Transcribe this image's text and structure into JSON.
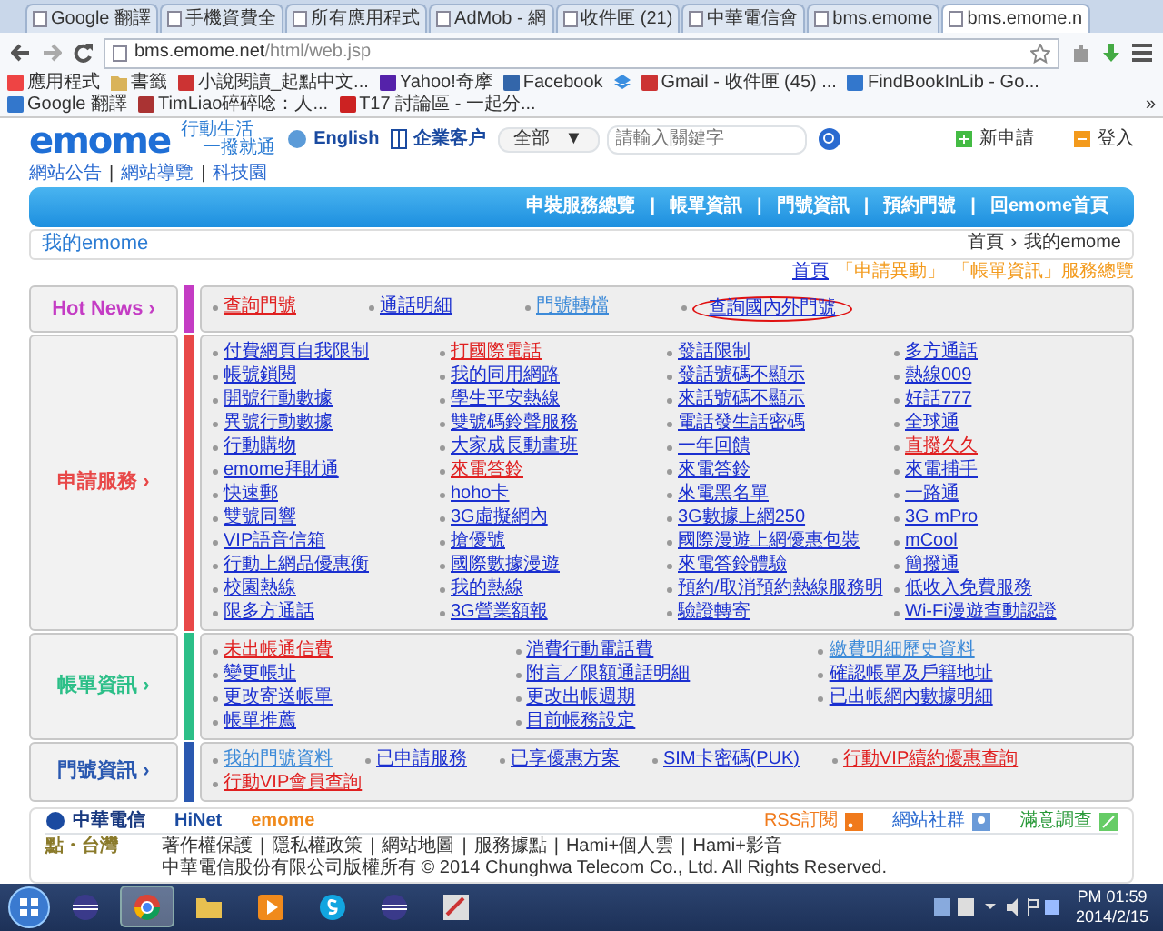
{
  "browser": {
    "tabs": [
      {
        "title": "Google 翻譯",
        "selected": false
      },
      {
        "title": "手機資費全",
        "selected": false
      },
      {
        "title": "所有應用程式",
        "selected": false
      },
      {
        "title": "AdMob - 網",
        "selected": false
      },
      {
        "title": "收件匣 (21)",
        "selected": false
      },
      {
        "title": "中華電信會",
        "selected": false
      },
      {
        "title": "bms.emome",
        "selected": false
      },
      {
        "title": "bms.emome.n",
        "selected": true
      }
    ],
    "url_host": "bms.emome.net",
    "url_path": "/html/web.jsp",
    "bookmarks": [
      "應用程式",
      "書籤",
      "小說閱讀_起點中文...",
      "Yahoo!奇摩",
      "Facebook",
      "Gmail - 收件匣 (45) ...",
      "FindBookInLib - Go...",
      "Google 翻譯",
      "TimLiao碎碎唸：人...",
      "T17 討論區 - 一起分..."
    ],
    "bookmarks_more": "»"
  },
  "header": {
    "logo": "emome",
    "slogan": [
      "行動生活",
      "一撥就通"
    ],
    "english": "English",
    "enterprise": "企業客户",
    "scope": "全部",
    "scope_arrow": "▼",
    "search_placeholder": "請輸入關鍵字",
    "new_apply": "新申請",
    "login": "登入"
  },
  "top_links": {
    "items": [
      "網站公告",
      "網站導覽",
      "科技園"
    ],
    "separator": "|"
  },
  "nav": {
    "items": [
      "申裝服務總覽",
      "帳單資訊",
      "門號資訊",
      "預約門號",
      "回emome首頁"
    ],
    "separator": "|"
  },
  "title_bar": {
    "title": "我的emome",
    "breadcrumb": [
      "首頁",
      "我的emome"
    ],
    "separator": "›"
  },
  "crumbs": [
    "首頁",
    "「申請異動」",
    "「帳單資訊」服務總覽"
  ],
  "sections": [
    {
      "title": "Hot News",
      "arrow": "›",
      "color": "#c43cc4",
      "kind": "inline",
      "items": [
        {
          "label": "查詢門號",
          "kind": "hot",
          "circled": false
        },
        {
          "label": "通話明細",
          "kind": "link",
          "circled": false
        },
        {
          "label": "門號轉檔",
          "kind": "visited",
          "circled": false
        },
        {
          "label": "查詢國內外門號",
          "kind": "link",
          "circled": true
        }
      ]
    },
    {
      "title": "申請服務",
      "arrow": "›",
      "color": "#e84848",
      "kind": "grid",
      "items": [
        {
          "label": "付費網頁自我限制",
          "kind": "link"
        },
        {
          "label": "打國際電話",
          "kind": "hot"
        },
        {
          "label": "發話限制",
          "kind": "link"
        },
        {
          "label": "多方通話",
          "kind": "link"
        },
        {
          "label": "帳號鎖閱",
          "kind": "link"
        },
        {
          "label": "我的同用網路",
          "kind": "link"
        },
        {
          "label": "發話號碼不顯示",
          "kind": "link"
        },
        {
          "label": "熱線009",
          "kind": "link"
        },
        {
          "label": "開號行動數據",
          "kind": "link"
        },
        {
          "label": "學生平安熱線",
          "kind": "link"
        },
        {
          "label": "來話號碼不顯示",
          "kind": "link"
        },
        {
          "label": "好話777",
          "kind": "link"
        },
        {
          "label": "異號行動數據",
          "kind": "link"
        },
        {
          "label": "雙號碼鈴聲服務",
          "kind": "link"
        },
        {
          "label": "電話發生話密碼",
          "kind": "link"
        },
        {
          "label": "全球通",
          "kind": "link"
        },
        {
          "label": "行動購物",
          "kind": "link"
        },
        {
          "label": "大家成長動畫班",
          "kind": "link"
        },
        {
          "label": "一年回饋",
          "kind": "link"
        },
        {
          "label": "直撥久久",
          "kind": "hot"
        },
        {
          "label": "emome拜財通",
          "kind": "link"
        },
        {
          "label": "來電答鈴",
          "kind": "hot"
        },
        {
          "label": "來電答鈴",
          "kind": "link"
        },
        {
          "label": "來電捕手",
          "kind": "link"
        },
        {
          "label": "快速郵",
          "kind": "link"
        },
        {
          "label": "hoho卡",
          "kind": "link"
        },
        {
          "label": "來電黑名單",
          "kind": "link"
        },
        {
          "label": "一路通",
          "kind": "link"
        },
        {
          "label": "雙號同響",
          "kind": "link"
        },
        {
          "label": "3G虛擬網內",
          "kind": "link"
        },
        {
          "label": "3G數據上網250",
          "kind": "link"
        },
        {
          "label": "3G mPro",
          "kind": "link"
        },
        {
          "label": "VIP語音信箱",
          "kind": "link"
        },
        {
          "label": "搶優號",
          "kind": "link"
        },
        {
          "label": "國際漫遊上網優惠包裝",
          "kind": "link"
        },
        {
          "label": "mCool",
          "kind": "link"
        },
        {
          "label": "行動上網品優惠衡",
          "kind": "link"
        },
        {
          "label": "國際數據漫遊",
          "kind": "link"
        },
        {
          "label": "來電答鈴體驗",
          "kind": "link"
        },
        {
          "label": "簡撥通",
          "kind": "link"
        },
        {
          "label": "校園熱線",
          "kind": "link"
        },
        {
          "label": "我的熱線",
          "kind": "link"
        },
        {
          "label": "預約/取消預約熱線服務明",
          "kind": "link"
        },
        {
          "label": "低收入免費服務",
          "kind": "link"
        },
        {
          "label": "限多方通話",
          "kind": "link"
        },
        {
          "label": "3G營業額報",
          "kind": "link"
        },
        {
          "label": "驗證轉寄",
          "kind": "link"
        },
        {
          "label": "Wi-Fi漫遊查動認證",
          "kind": "link"
        }
      ]
    },
    {
      "title": "帳單資訊",
      "arrow": "›",
      "color": "#2cbf88",
      "kind": "table",
      "items": [
        {
          "label": "未出帳通信費",
          "kind": "hot"
        },
        {
          "label": "消費行動電話費",
          "kind": "link"
        },
        {
          "label": "繳費明細歷史資料",
          "kind": "visited"
        },
        {
          "label": "變更帳址",
          "kind": "link"
        },
        {
          "label": "附言／限額通話明細",
          "kind": "link"
        },
        {
          "label": "確認帳單及戶籍地址",
          "kind": "link"
        },
        {
          "label": "更改寄送帳單",
          "kind": "link"
        },
        {
          "label": "更改出帳週期",
          "kind": "link"
        },
        {
          "label": "已出帳網內數據明細",
          "kind": "link"
        },
        {
          "label": "帳單推薦",
          "kind": "link"
        },
        {
          "label": "目前帳務設定",
          "kind": "link"
        }
      ]
    },
    {
      "title": "門號資訊",
      "arrow": "›",
      "color": "#2a58b0",
      "kind": "inline",
      "items": [
        {
          "label": "我的門號資料",
          "kind": "visited"
        },
        {
          "label": "已申請服務",
          "kind": "link"
        },
        {
          "label": "已享優惠方案",
          "kind": "link"
        },
        {
          "label": "SIM卡密碼(PUK)",
          "kind": "link"
        },
        {
          "label": "行動VIP續約優惠查詢",
          "kind": "hot"
        },
        {
          "label": "行動VIP會員查詢",
          "kind": "hot"
        }
      ]
    }
  ],
  "footer": {
    "brands": [
      "中華電信",
      "HiNet",
      "emome"
    ],
    "badge": "點・台灣",
    "actions": [
      "RSS訂閱",
      "網站社群",
      "滿意調查"
    ],
    "link_separator": "|",
    "links": [
      "著作權保護",
      "隱私權政策",
      "網站地圖",
      "服務據點",
      "Hami+個人雲",
      "Hami+影音"
    ],
    "copyright": "中華電信股份有限公司版權所有 © 2014 Chunghwa Telecom Co., Ltd. All Rights Reserved."
  },
  "taskbar": {
    "apps": [
      {
        "kind": "eclipse",
        "selected": false
      },
      {
        "kind": "chrome",
        "selected": true
      },
      {
        "kind": "folder",
        "selected": false
      },
      {
        "kind": "media",
        "selected": false
      },
      {
        "kind": "skype",
        "selected": false
      },
      {
        "kind": "eclipse",
        "selected": false
      },
      {
        "kind": "editor",
        "selected": false
      }
    ],
    "time": "PM 01:59",
    "date": "2014/2/15"
  }
}
